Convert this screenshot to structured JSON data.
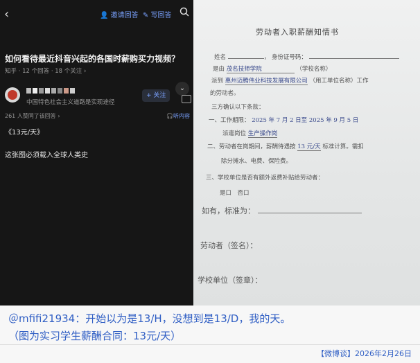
{
  "left": {
    "invite_label": "邀请回答",
    "write_label": "写回答",
    "question_title": "如何看待最近抖音兴起的各国时薪购买力视频？",
    "question_meta": "知乎 · 12 个回答 · 18 个关注 ›",
    "user_subtitle": "中国特色社会主义道路是实现途径",
    "follow_label": "+ 关注",
    "agree_text": "261 人赞同了该回答 ›",
    "listen_label": "听内容",
    "answer_line1": "《13元/天》",
    "answer_line2": "这张图必须载入全球人类史"
  },
  "doc": {
    "title": "劳动者入职薪酬知情书",
    "line_name": "姓名",
    "line_id": "身份证号码：",
    "line_school_prefix": "是由",
    "line_school": "茂名技师学院",
    "line_school_suffix": "（学校名称）",
    "line_company_prefix": "派到",
    "line_company": "惠州迈腾伟业科技发展有限公司",
    "line_company_suffix": "（用工单位名称）工作",
    "line_worker": "的劳动者。",
    "confirm": "三方确认以下条款：",
    "item1_label": "一、工作期限：",
    "item1_value": "2025 年 7 月 2 日至 2025 年 9 月 5 日",
    "item1b_label": "派遣岗位",
    "item1b_value": "生产操作岗",
    "item2_a": "二、劳动者在岗期间，薪酬待遇按",
    "item2_value": "13 元/天",
    "item2_b": "标准计算。需扣",
    "item2_c": "除分摊水、电费、保险费。",
    "item3": "三、学校单位是否有额外返费补贴给劳动者：",
    "item3_opts": "是口　否口",
    "if_yes": "如有，标准为：",
    "worker_sign": "劳动者（签名）：",
    "school_sign": "学校单位（签章）："
  },
  "caption": {
    "line1": "＠mfifi21934：开始以为是13/H，没想到是13/D，我的天。",
    "line2": "（图为实习学生薪酬合同：13元/天）",
    "footer": "【微博谈】2026年2月26日"
  },
  "colors": {
    "caption_blue": "#2f5ec4",
    "link_blue": "#7aa2ff",
    "dark_bg": "#161616"
  }
}
